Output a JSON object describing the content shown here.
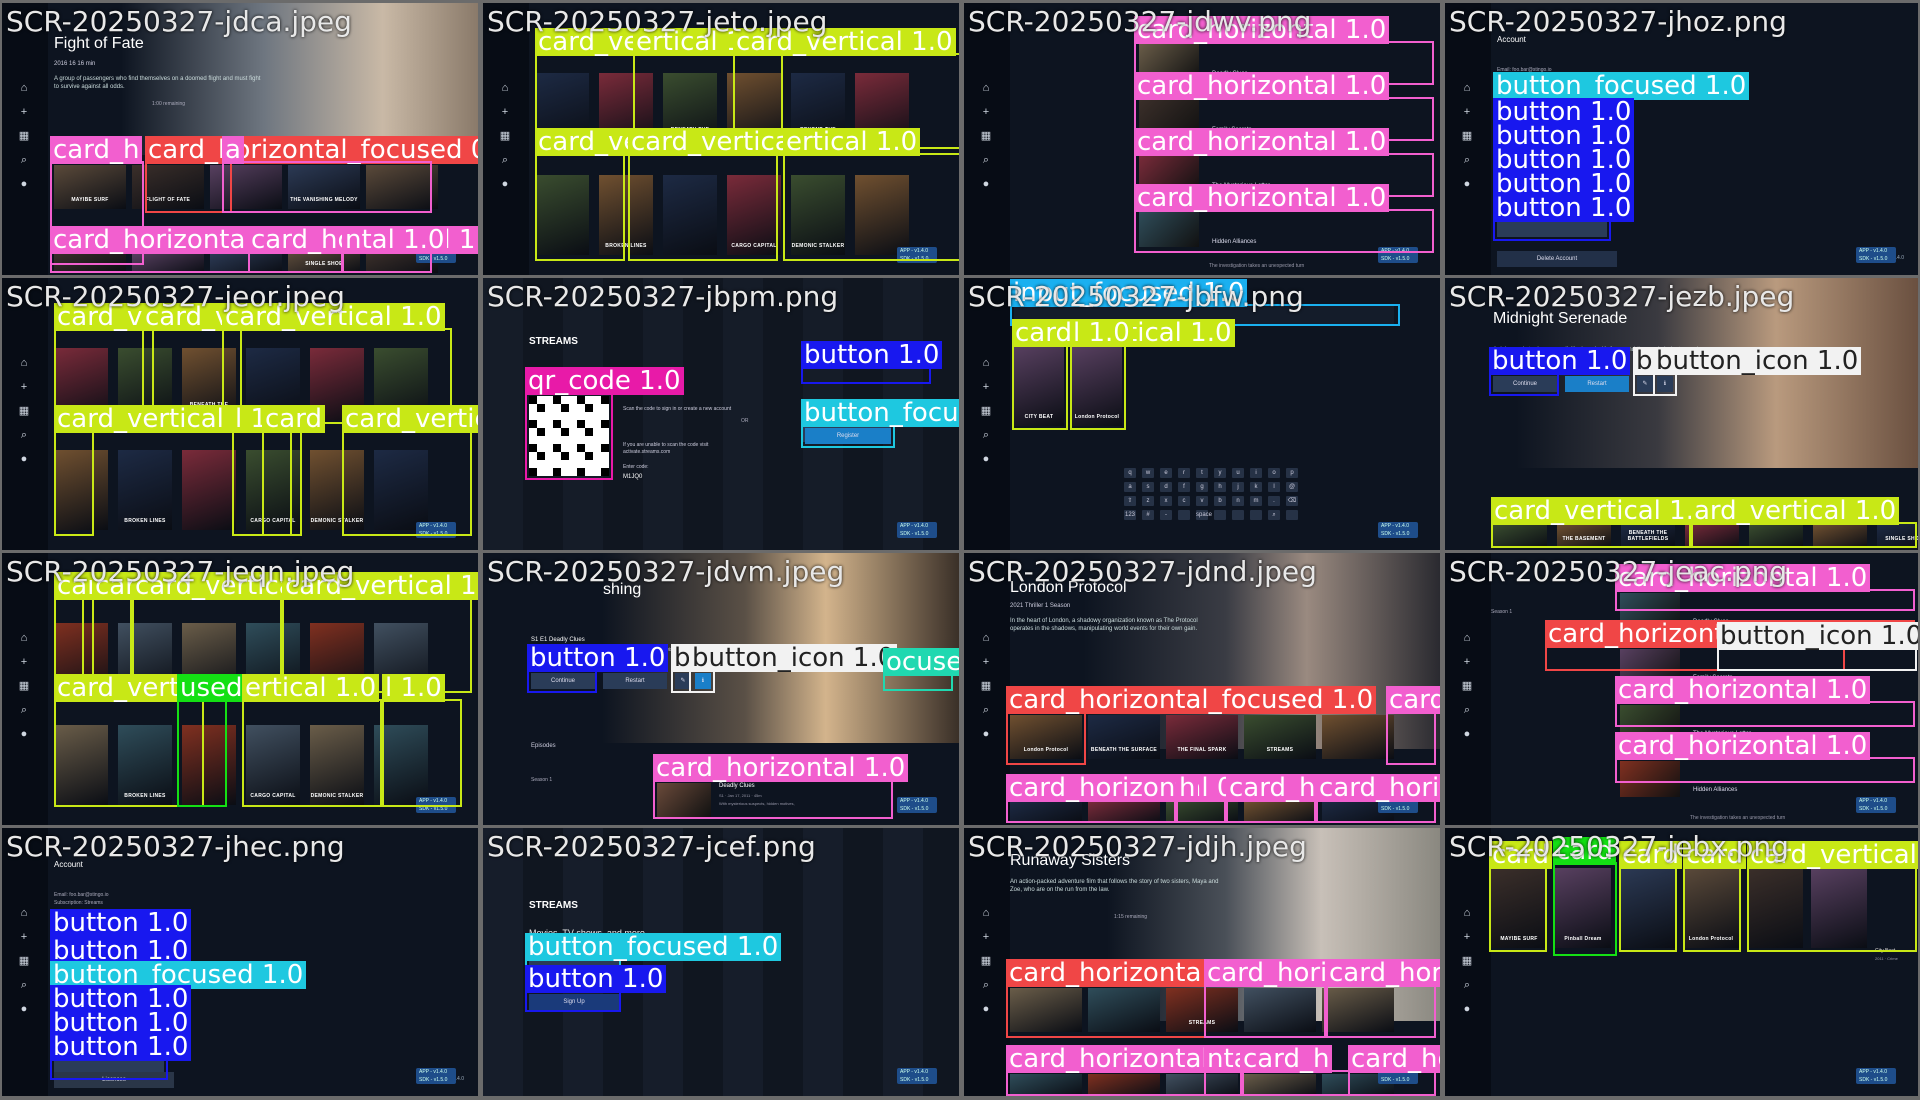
{
  "colors": {
    "card_vertical": "#c8e816",
    "card_horizontal": "#f25fcf",
    "card_horizontal_focused": "#f04646",
    "button": "#1818ef",
    "button_focused": "#1ec8e0",
    "button_icon": "#f2f2f2",
    "input_focused": "#1ab0f0",
    "qr_code": "#e81aa8"
  },
  "sidebar_icons": [
    "home-icon",
    "plus-icon",
    "grid-icon",
    "search-icon",
    "profile-icon"
  ],
  "common": {
    "badge": "APP - v1.4.0\nSDK - v1.5.0",
    "version": "v1.4.0"
  },
  "tiles": [
    {
      "title": "SCR-20250327-jdca.jpeg",
      "show": "Fight of Fate",
      "meta": "2016  16  16 min",
      "desc": "A group of passengers who find themselves on a doomed flight and must fight to survive against all odds.",
      "row_caption": "1:00 remaining",
      "posters": [
        "MAYIBE SURF",
        "FLIGHT OF FATE",
        "",
        "THE VANISHING MELODY",
        "",
        "",
        "",
        "",
        "SINGLE SHOE",
        ""
      ],
      "labels": [
        [
          "card_h",
          "c-ch"
        ],
        [
          "card_horizontal_focused 0.9",
          "c-chf"
        ],
        [
          "a",
          "c-ch"
        ],
        [
          "card_horizonta",
          "c-ch"
        ],
        [
          "card_horizontal 1.0",
          "c-ch"
        ],
        [
          "ntal 1.0",
          "c-ch"
        ]
      ]
    },
    {
      "title": "SCR-20250327-jeto.jpeg",
      "posters": [
        "",
        "THE BASEMENT",
        "BENEATH THE BATTLEFIELDS",
        "",
        "BEYOND THE SHADOWS",
        "",
        "",
        "BROKEN LINES",
        "",
        "CARGO CAPITAL",
        "DEMONIC STALKER",
        ""
      ],
      "labels": [
        [
          "card_vertical 1.0",
          "c-cv"
        ],
        [
          "ertical 1",
          "c-cv"
        ],
        [
          "card_vertical 1.0",
          "c-cv"
        ],
        [
          "card_verti",
          "c-cv"
        ],
        [
          "card_vertical 1.0",
          "c-cv"
        ],
        [
          "ertical 1.0",
          "c-cv"
        ]
      ]
    },
    {
      "title": "SCR-20250327-jdwv.png",
      "episodes": [
        "Deadly Clues",
        "Family Secrets",
        "The Mysterious Letter",
        "Hidden Alliances"
      ],
      "ep_desc": "The investigation takes an unexpected turn",
      "labels": [
        [
          "card_horizontal 1.0",
          "c-ch"
        ],
        [
          "card_horizontal 1.0",
          "c-ch"
        ],
        [
          "card_horizontal 1.0",
          "c-ch"
        ],
        [
          "card_horizontal 1.0",
          "c-ch"
        ]
      ]
    },
    {
      "title": "SCR-20250327-jhoz.png",
      "heading": "Account",
      "email": "Email: foo.bar@stingo.io",
      "subs": "Subscription: Streams",
      "delete": "Delete Account",
      "labels": [
        [
          "button_focused 1.0",
          "c-bf"
        ],
        [
          "button 1.0",
          "c-bt"
        ],
        [
          "button 1.0",
          "c-bt"
        ],
        [
          "button 1.0",
          "c-bt"
        ],
        [
          "button 1.0",
          "c-bt"
        ],
        [
          "button 1.0",
          "c-bt"
        ]
      ]
    },
    {
      "title": "SCR-20250327-jeor.jpeg",
      "posters": [
        "",
        "THE BASEMENT",
        "BENEATH THE BATTLEFIELDS",
        "",
        "",
        "",
        "",
        "BROKEN LINES",
        "",
        "CARGO CAPITAL",
        "DEMONIC STALKER",
        ""
      ],
      "labels": [
        [
          "card_verti",
          "c-cv"
        ],
        [
          "card_vertical 1",
          "c-cv"
        ],
        [
          "card_vertical 1.0",
          "c-cv"
        ],
        [
          "card_vertical 1.0",
          "c-cv"
        ],
        [
          "l 1",
          "c-cv"
        ],
        [
          "card",
          "c-cv"
        ],
        [
          "card_vertical 1.0",
          "c-cv"
        ]
      ]
    },
    {
      "title": "SCR-20250327-jbpm.png",
      "brand": "STREAMS",
      "scan": "Scan the code to sign in or create a new account",
      "or": "OR",
      "unable": "If you are unable to scan the code visit activate.streams.com",
      "enter": "Enter code:",
      "code": "M1JQ0",
      "register": "Register",
      "labels": [
        [
          "qr_code 1.0",
          "c-qr"
        ],
        [
          "button 1.0",
          "c-bt"
        ],
        [
          "button_focused 1.0",
          "c-bf"
        ]
      ]
    },
    {
      "title": "SCR-20250327-jbfw.png",
      "result": "CITY BEAT",
      "result2": "London Protocol",
      "keys": [
        "q",
        "w",
        "e",
        "r",
        "t",
        "y",
        "u",
        "i",
        "o",
        "p",
        "a",
        "s",
        "d",
        "f",
        "g",
        "h",
        "j",
        "k",
        "l",
        "@",
        "⇧",
        "z",
        "x",
        "c",
        "v",
        "b",
        "n",
        "m",
        ".",
        "⌫",
        "123",
        "#",
        "-",
        "",
        "space",
        "",
        "",
        "",
        "⌕",
        ""
      ],
      "labels": [
        [
          "input_focused 1.0",
          "c-if"
        ],
        [
          "card_vertical 1.0",
          "c-cv"
        ],
        [
          "l 1.0",
          "c-cv"
        ]
      ]
    },
    {
      "title": "SCR-20250327-jezb.jpeg",
      "show": "Midnight Serenade",
      "desc": "A rising rockstar becomes disillusioned with fame and the music industry, and decides",
      "continue": "Continue",
      "restart": "Restart",
      "posters": [
        "",
        "THE BASEMENT",
        "BENEATH THE BATTLEFIELDS",
        "",
        "",
        "",
        "SINGLE SHOE"
      ],
      "labels": [
        [
          "button 1.0",
          "c-bt"
        ],
        [
          "b",
          "c-bi"
        ],
        [
          "button_icon 1.0",
          "c-bi"
        ],
        [
          "card_vertical 1.0",
          "c-cv"
        ],
        [
          "ard_vertical 1.0",
          "c-cv"
        ]
      ]
    },
    {
      "title": "SCR-20250327-jeqn.jpeg",
      "posters": [
        "",
        "THE BASEMENT",
        "BENEATH THE BATTLEFIELDS",
        "",
        "",
        "",
        "",
        "BROKEN LINES",
        "",
        "CARGO CAPITAL",
        "DEMONIC STALKER",
        ""
      ],
      "labels": [
        [
          "card",
          "c-cv"
        ],
        [
          "card",
          "c-cv"
        ],
        [
          "card_vertical 1",
          "c-cv"
        ],
        [
          "card_vertical 1.0",
          "c-cv"
        ],
        [
          "card_vertical 0.9",
          "c-cv"
        ],
        [
          "used 0.9",
          "c-cvf"
        ],
        [
          "ertical 1.0",
          "c-cv"
        ],
        [
          "l 1.0",
          "c-cv"
        ]
      ]
    },
    {
      "title": "SCR-20250327-jdvm.jpeg",
      "show": "shing",
      "ep_code": "S1 E1 Deadly Clues",
      "desc": "With mysterious suspects, hidden motives, and unexpected twists, Jack races against time to solve the case and",
      "continue": "Continue",
      "restart": "Restart",
      "episodes": "Episodes",
      "season": "Season 1",
      "ep": "Deadly Clues",
      "ep_meta": "S1 · Jan 17, 2011 · 45m",
      "ep_desc": "With mysterious suspects, hidden motives,",
      "labels": [
        [
          "button 1.0",
          "c-bt"
        ],
        [
          "b",
          "c-bi"
        ],
        [
          "button_icon 1.0",
          "c-bi"
        ],
        [
          "ocused 1.0",
          "c-bif"
        ],
        [
          "card_horizontal 1.0",
          "c-ch"
        ]
      ]
    },
    {
      "title": "SCR-20250327-jdnd.jpeg",
      "show": "London Protocol",
      "meta": "2021  Thriller  1 Season",
      "desc": "In the heart of London, a shadowy organization known as The Protocol operates in the shadows, manipulating world events for their own gain.",
      "posters": [
        "London Protocol",
        "BENEATH THE SURFACE",
        "THE FINAL SPARK",
        "STREAMS",
        "",
        "",
        "",
        "",
        "",
        ""
      ],
      "labels": [
        [
          "card_horizontal_focused 1.0",
          "c-chf"
        ],
        [
          "card_horizontal",
          "c-ch"
        ],
        [
          "card_horizontal 0.9",
          "c-ch"
        ],
        [
          "h",
          "c-ch"
        ],
        [
          "card_h",
          "c-ch"
        ],
        [
          "card_horizontal 0.4",
          "c-ch"
        ]
      ]
    },
    {
      "title": "SCR-20250327-jeac.png",
      "season": "Season 1",
      "episodes": [
        "Deadly Clues",
        "Family Secrets",
        "The Mysterious Letter",
        "Hidden Alliances"
      ],
      "ep_desc": "The investigation takes an unexpected turn",
      "labels": [
        [
          "card_horizontal 1.0",
          "c-ch"
        ],
        [
          "card_horizontal_focused 1.0",
          "c-chf"
        ],
        [
          "button_icon 1.0",
          "c-bi"
        ],
        [
          "card_horizontal 1.0",
          "c-ch"
        ],
        [
          "card_horizontal 1.0",
          "c-ch"
        ]
      ]
    },
    {
      "title": "SCR-20250327-jhec.png",
      "heading": "Account",
      "email": "Email: foo.bar@stingo.io",
      "subs": "Subscription: Streams",
      "licences": "Licences",
      "labels": [
        [
          "button 1.0",
          "c-bt"
        ],
        [
          "button 1.0",
          "c-bt"
        ],
        [
          "button_focused 1.0",
          "c-bf"
        ],
        [
          "button 1.0",
          "c-bt"
        ],
        [
          "button 1.0",
          "c-bt"
        ],
        [
          "button 1.0",
          "c-bt"
        ]
      ]
    },
    {
      "title": "SCR-20250327-jcef.png",
      "brand": "STREAMS",
      "tagline": "Movies, TV shows, and more.",
      "signup": "Sign Up",
      "labels": [
        [
          "button_focused 1.0",
          "c-bf"
        ],
        [
          "button 1.0",
          "c-bt"
        ]
      ]
    },
    {
      "title": "SCR-20250327-jdjh.jpeg",
      "show": "Runaway Sisters",
      "desc": "An action-packed adventure film that follows the story of two sisters, Maya and Zoe, who are on the run from the law.",
      "remaining": "1:15 remaining",
      "posters": [
        "",
        "",
        "STREAMS",
        "",
        "",
        "",
        "",
        "",
        "",
        ""
      ],
      "labels": [
        [
          "card_horizonta",
          "c-chf"
        ],
        [
          "card_horizonta",
          "c-ch"
        ],
        [
          "card_horizontal 0.8",
          "c-ch"
        ],
        [
          "card_horizontal 0.9",
          "c-ch"
        ],
        [
          "nta",
          "c-ch"
        ],
        [
          "card_h",
          "c-ch"
        ],
        [
          "card_horizontal 0.8",
          "c-ch"
        ]
      ]
    },
    {
      "title": "SCR-20250327-jebx.png",
      "caption": "City Beat",
      "caption2": "2011 · Crime",
      "posters": [
        "MAYIBE SURF",
        "Pinball Dream",
        "",
        "London Protocol",
        "",
        ""
      ],
      "labels": [
        [
          "card",
          "c-cv"
        ],
        [
          "card",
          "c-cvf"
        ],
        [
          "card",
          "c-cv"
        ],
        [
          "card",
          "c-cv"
        ],
        [
          "card_vertical 1.0",
          "c-cv"
        ]
      ]
    }
  ]
}
